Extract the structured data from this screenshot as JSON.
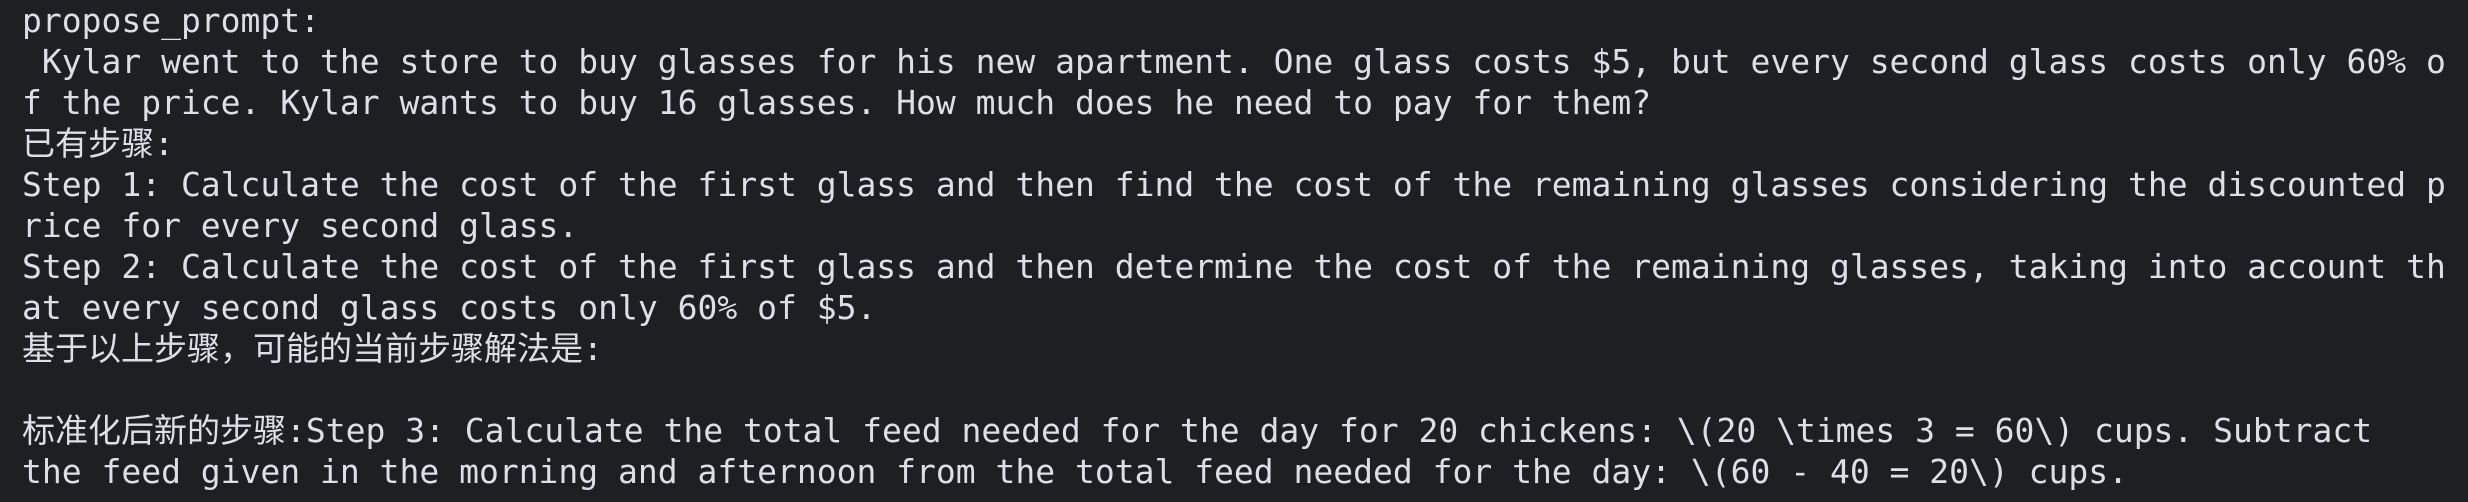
{
  "terminal": {
    "lines": [
      "propose_prompt:",
      " Kylar went to the store to buy glasses for his new apartment. One glass costs $5, but every second glass costs only 60% o",
      "f the price. Kylar wants to buy 16 glasses. How much does he need to pay for them?",
      "已有步骤:",
      "Step 1: Calculate the cost of the first glass and then find the cost of the remaining glasses considering the discounted p",
      "rice for every second glass.",
      "Step 2: Calculate the cost of the first glass and then determine the cost of the remaining glasses, taking into account th",
      "at every second glass costs only 60% of $5.",
      "基于以上步骤，可能的当前步骤解法是:",
      "",
      "标准化后新的步骤:Step 3: Calculate the total feed needed for the day for 20 chickens: \\(20 \\times 3 = 60\\) cups. Subtract",
      "the feed given in the morning and afternoon from the total feed needed for the day: \\(60 - 40 = 20\\) cups."
    ]
  }
}
